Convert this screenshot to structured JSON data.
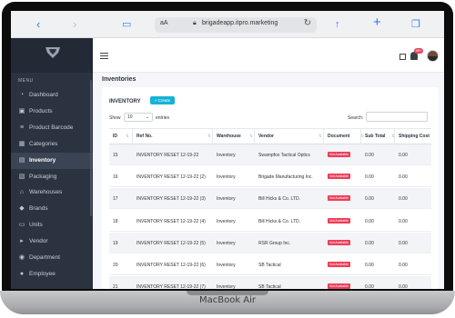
{
  "browser": {
    "url_prefix": "aA",
    "url": "brigadeapp.itpro.marketing"
  },
  "laptop": {
    "model": "MacBook Air"
  },
  "sidebar": {
    "menu_title": "MENU",
    "items": [
      {
        "label": "Dashboard",
        "icon": "dashboard-icon"
      },
      {
        "label": "Products",
        "icon": "box-icon"
      },
      {
        "label": "Product Barcode",
        "icon": "barcode-icon"
      },
      {
        "label": "Categories",
        "icon": "grid-icon"
      },
      {
        "label": "Inventory",
        "icon": "clipboard-icon",
        "active": true
      },
      {
        "label": "Packaging",
        "icon": "package-icon"
      },
      {
        "label": "Warehouses",
        "icon": "warehouse-icon"
      },
      {
        "label": "Brands",
        "icon": "tag-icon"
      },
      {
        "label": "Units",
        "icon": "ruler-icon"
      },
      {
        "label": "Vendor",
        "icon": "truck-icon"
      },
      {
        "label": "Department",
        "icon": "users-icon"
      },
      {
        "label": "Employee",
        "icon": "user-icon"
      }
    ]
  },
  "topbar": {
    "notification_count": "99+"
  },
  "page": {
    "title": "Inventories"
  },
  "card": {
    "title": "INVENTORY",
    "create_label": "+ Create",
    "show_label": "Show",
    "entries_value": "10",
    "entries_label": "entries",
    "search_label": "Search:"
  },
  "table": {
    "columns": [
      "ID",
      "Ref No.",
      "Warehouse",
      "Vendor",
      "Document",
      "Sub Total",
      "Shipping Cost"
    ],
    "rows": [
      {
        "id": "15",
        "ref": "INVENTORY RESET 12-19-22",
        "warehouse": "Inventory",
        "vendor": "Swampfox Tactical Optics",
        "document": "Not Available",
        "subtotal": "0.00",
        "shipping": "0.00"
      },
      {
        "id": "16",
        "ref": "INVENTORY RESET 12-19-22 (2)",
        "warehouse": "Inventory",
        "vendor": "Brigade Manufacturing Inc.",
        "document": "Not Available",
        "subtotal": "0.00",
        "shipping": "0.00"
      },
      {
        "id": "17",
        "ref": "INVENTORY RESET 12-19-22 (3)",
        "warehouse": "Inventory",
        "vendor": "Bill Hicks & Co. LTD.",
        "document": "Not Available",
        "subtotal": "0.00",
        "shipping": "0.00"
      },
      {
        "id": "18",
        "ref": "INVENTORY RESET 12-19-22 (4)",
        "warehouse": "Inventory",
        "vendor": "Bill Hicks & Co. LTD.",
        "document": "Not Available",
        "subtotal": "0.00",
        "shipping": "0.00"
      },
      {
        "id": "19",
        "ref": "INVENTORY RESET 12-19-22 (5)",
        "warehouse": "Inventory",
        "vendor": "RSR Group Inc.",
        "document": "Not Available",
        "subtotal": "0.00",
        "shipping": "0.00"
      },
      {
        "id": "20",
        "ref": "INVENTORY RESET 12-19-22 (6)",
        "warehouse": "Inventory",
        "vendor": "SB Tactical",
        "document": "Not Available",
        "subtotal": "0.00",
        "shipping": "0.00"
      },
      {
        "id": "21",
        "ref": "INVENTORY RESET 12-19-22 (7)",
        "warehouse": "Inventory",
        "vendor": "SB Tactical",
        "document": "Not Available",
        "subtotal": "0.00",
        "shipping": "0.00"
      }
    ]
  },
  "colors": {
    "sidebar_bg": "#2b3240",
    "accent": "#16b2d6",
    "badge": "#ee3d58"
  }
}
